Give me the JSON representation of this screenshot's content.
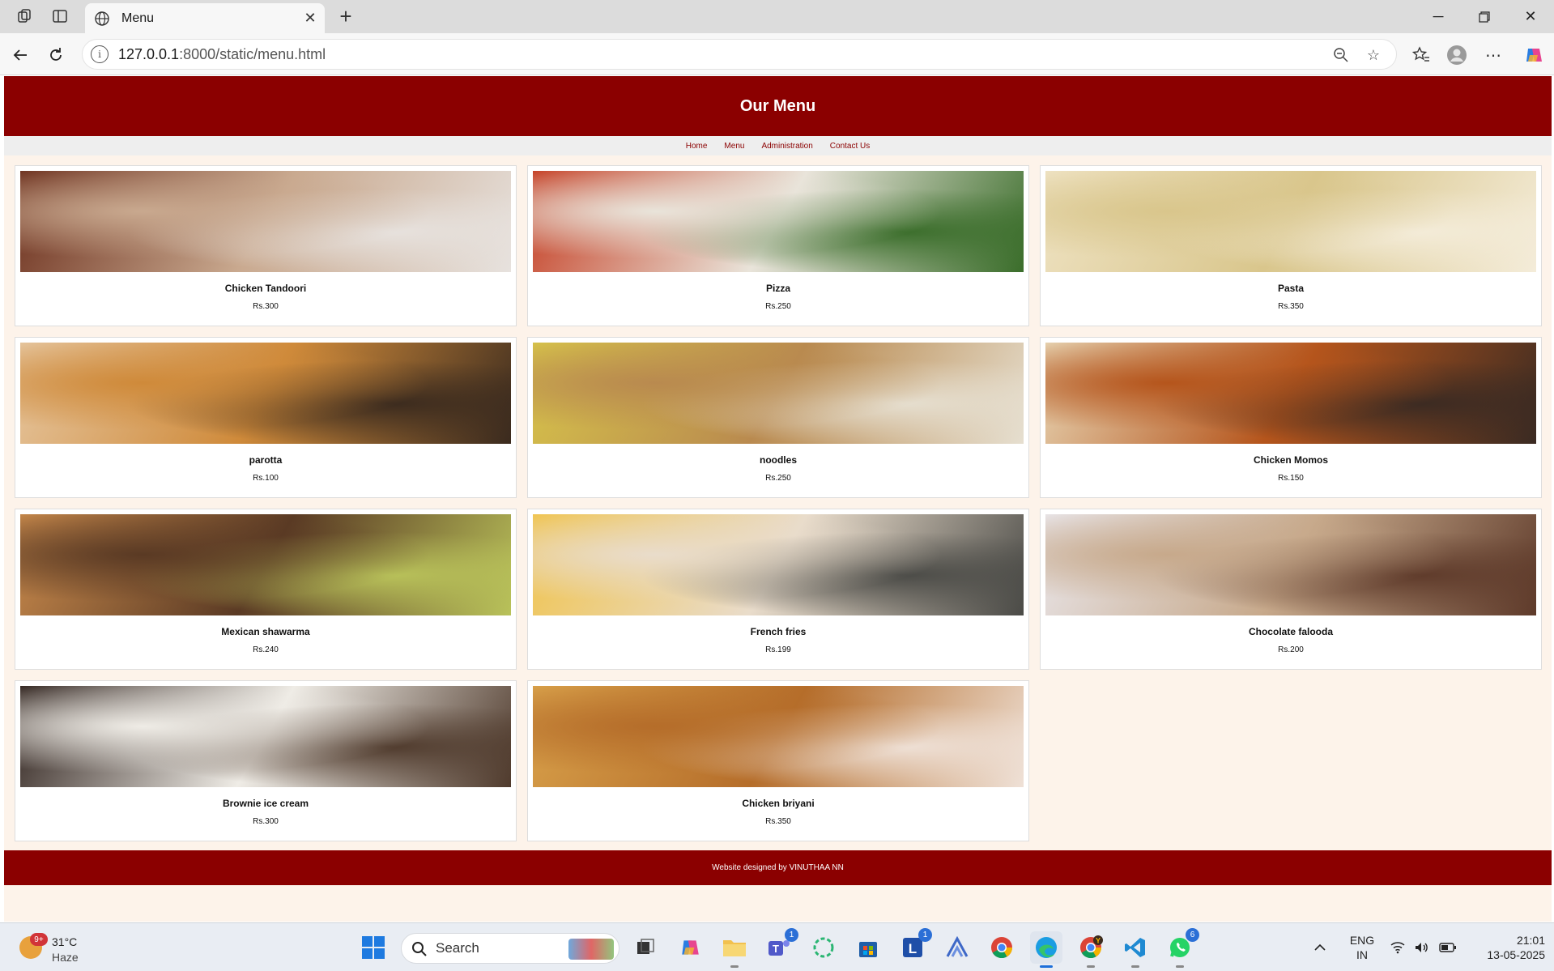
{
  "browser": {
    "tab_title": "Menu",
    "url_host": "127.0.0.1",
    "url_path": ":8000/static/menu.html"
  },
  "page": {
    "title": "Our Menu",
    "nav": [
      {
        "label": "Home"
      },
      {
        "label": "Menu"
      },
      {
        "label": "Administration"
      },
      {
        "label": "Contact Us"
      }
    ],
    "items": [
      {
        "name": "Chicken Tandoori",
        "price": "Rs.300",
        "colors": [
          "#6b2e1c",
          "#c9a98f",
          "#e7e2de"
        ]
      },
      {
        "name": "Pizza",
        "price": "Rs.250",
        "colors": [
          "#c43a1f",
          "#e9e4da",
          "#3a6d2a"
        ]
      },
      {
        "name": "Pasta",
        "price": "Rs.350",
        "colors": [
          "#efe3c4",
          "#d9c68c",
          "#f4ecd9"
        ]
      },
      {
        "name": "parotta",
        "price": "Rs.100",
        "colors": [
          "#e6c7a1",
          "#cf8a3a",
          "#3a2a1e"
        ]
      },
      {
        "name": "noodles",
        "price": "Rs.250",
        "colors": [
          "#d7c44a",
          "#b98a4f",
          "#e6dfd0"
        ]
      },
      {
        "name": "Chicken Momos",
        "price": "Rs.150",
        "colors": [
          "#e8d7b6",
          "#b5551c",
          "#3a2a22"
        ]
      },
      {
        "name": "Mexican shawarma",
        "price": "Rs.240",
        "colors": [
          "#c98a4c",
          "#5a3a24",
          "#b9c25a"
        ]
      },
      {
        "name": "French fries",
        "price": "Rs.199",
        "colors": [
          "#f0c34b",
          "#e9dccb",
          "#4a4a46"
        ]
      },
      {
        "name": "Chocolate falooda",
        "price": "Rs.200",
        "colors": [
          "#e9e6ea",
          "#c7a98b",
          "#5e3a2a"
        ]
      },
      {
        "name": "Brownie ice cream",
        "price": "Rs.300",
        "colors": [
          "#2b1e19",
          "#efece6",
          "#4f3a2c"
        ]
      },
      {
        "name": "Chicken briyani",
        "price": "Rs.350",
        "colors": [
          "#d9a24b",
          "#b56d2a",
          "#efe1d7"
        ]
      }
    ],
    "footer": "Website designed by VINUTHAA NN"
  },
  "taskbar": {
    "weather_badge": "9+",
    "temperature": "31°C",
    "condition": "Haze",
    "search_label": "Search",
    "teams_count": "1",
    "l_count": "1",
    "whatsapp_count": "6",
    "lang_top": "ENG",
    "lang_bottom": "IN",
    "time": "21:01",
    "date": "13-05-2025"
  }
}
